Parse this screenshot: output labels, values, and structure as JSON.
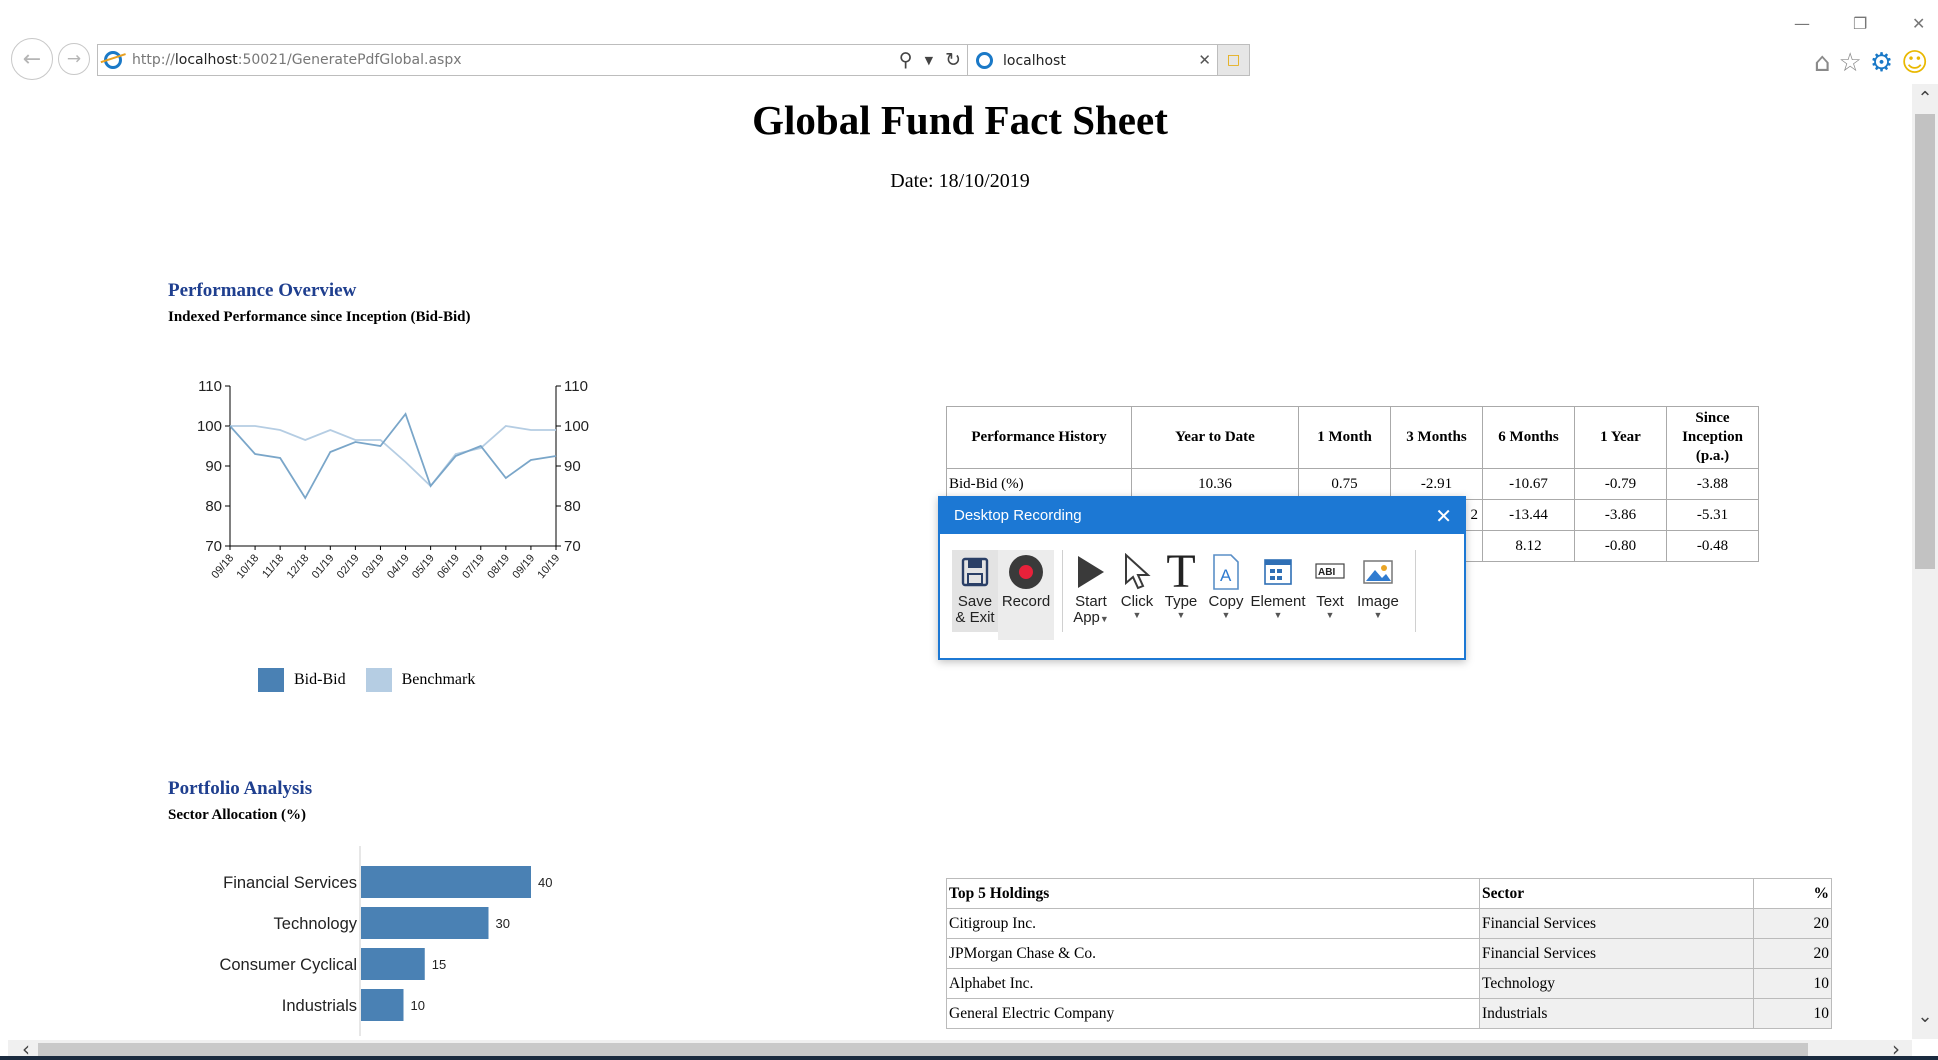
{
  "browser": {
    "url_prefix": "http://",
    "url_host": "localhost",
    "url_rest": ":50021/GeneratePdfGlobal.aspx",
    "tab_title": "localhost"
  },
  "report": {
    "title": "Global Fund Fact Sheet",
    "date": "Date: 18/10/2019",
    "perf_heading": "Performance Overview",
    "perf_subheading": "Indexed Performance since Inception (Bid-Bid)",
    "portfolio_heading": "Portfolio Analysis",
    "portfolio_subheading": "Sector Allocation (%)"
  },
  "legend": {
    "bid": "Bid-Bid",
    "benchmark": "Benchmark"
  },
  "chart_data": [
    {
      "type": "line",
      "x": [
        "09/18",
        "10/18",
        "11/18",
        "12/18",
        "01/19",
        "02/19",
        "03/19",
        "04/19",
        "05/19",
        "06/19",
        "07/19",
        "08/19",
        "09/19",
        "10/19"
      ],
      "series": [
        {
          "name": "Bid-Bid",
          "values": [
            100,
            93,
            92,
            82,
            93.5,
            96,
            95,
            103,
            85,
            92.5,
            95,
            87,
            91.5,
            92.5
          ],
          "color": "#7aa6c9"
        },
        {
          "name": "Benchmark",
          "values": [
            100,
            100,
            99,
            96.5,
            99,
            96.5,
            96.5,
            91,
            85,
            93,
            94.5,
            100,
            99,
            99
          ],
          "color": "#b5cde3"
        }
      ],
      "ylim": [
        70,
        110
      ],
      "yticks": [
        70,
        80,
        90,
        100,
        110
      ],
      "dual_y_axis": true
    },
    {
      "type": "bar",
      "orientation": "horizontal",
      "categories": [
        "Financial Services",
        "Technology",
        "Consumer Cyclical",
        "Industrials"
      ],
      "values": [
        40,
        30,
        15,
        10
      ],
      "color": "#4a81b4"
    }
  ],
  "performance_table": {
    "headers": [
      "Performance History",
      "Year to Date",
      "1 Month",
      "3 Months",
      "6 Months",
      "1 Year",
      "Since Inception (p.a.)"
    ],
    "rows": [
      [
        "Bid-Bid (%)",
        "10.36",
        "0.75",
        "-2.91",
        "-10.67",
        "-0.79",
        "-3.88"
      ],
      [
        "",
        "",
        "",
        "2",
        "-13.44",
        "-3.86",
        "-5.31"
      ],
      [
        "",
        "",
        "",
        "",
        "8.12",
        "-0.80",
        "-0.48"
      ]
    ]
  },
  "holdings_table": {
    "headers": [
      "Top 5 Holdings",
      "Sector",
      "%"
    ],
    "rows": [
      [
        "Citigroup Inc.",
        "Financial Services",
        "20"
      ],
      [
        "JPMorgan Chase & Co.",
        "Financial Services",
        "20"
      ],
      [
        "Alphabet Inc.",
        "Technology",
        "10"
      ],
      [
        "General Electric Company",
        "Industrials",
        "10"
      ]
    ]
  },
  "recorder": {
    "title": "Desktop Recording",
    "tools": [
      {
        "line1": "Save",
        "line2": "& Exit",
        "icon": "save-icon",
        "dropdown": false
      },
      {
        "line1": "Record",
        "line2": "",
        "icon": "record-icon",
        "dropdown": false
      },
      {
        "line1": "Start",
        "line2": "App",
        "icon": "play-icon",
        "dropdown": true
      },
      {
        "line1": "Click",
        "line2": "",
        "icon": "cursor-icon",
        "dropdown": true
      },
      {
        "line1": "Type",
        "line2": "",
        "icon": "type-icon",
        "dropdown": true
      },
      {
        "line1": "Copy",
        "line2": "",
        "icon": "copy-icon",
        "dropdown": true
      },
      {
        "line1": "Element",
        "line2": "",
        "icon": "element-icon",
        "dropdown": true
      },
      {
        "line1": "Text",
        "line2": "",
        "icon": "text-icon",
        "dropdown": true
      },
      {
        "line1": "Image",
        "line2": "",
        "icon": "image-icon",
        "dropdown": true
      }
    ],
    "accent": "#1c78d4",
    "record_color": "#e8213a"
  }
}
